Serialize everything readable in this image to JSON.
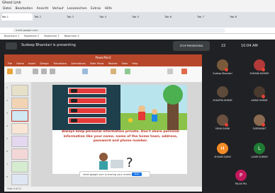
{
  "browser": {
    "title": "Ghost Link",
    "menu": [
      "Datei",
      "Bearbeiten",
      "Ansicht",
      "Verlauf",
      "Lesezeichen",
      "Extras",
      "Hilfe"
    ],
    "tabs": [
      "Tab 1",
      "Tab 2",
      "Tab 3",
      "Tab 4",
      "Tab 5",
      "Tab 6",
      "Tab 7",
      "Tab 8"
    ],
    "address": "meet.google.com",
    "bookmarks": [
      "Bookmark 1",
      "Bookmark 2",
      "Bookmark 3",
      "Bookmark 4"
    ]
  },
  "meet": {
    "presenting_label": "Sudeep Bhandari is presenting",
    "stop_presenting": "STOP PRESENTING",
    "people_count": "22",
    "clock": "10:04 AM"
  },
  "powerpoint": {
    "window_title": "PowerPoint",
    "ribbon_tabs": [
      "File",
      "Home",
      "Insert",
      "Design",
      "Transitions",
      "Animations",
      "Slide Show",
      "Review",
      "View",
      "Help"
    ],
    "slide_text": "Always keep personal information private. Don't share personal information like your name, name of the home town, address, password and phone number.",
    "share_bar_text": "meet.google.com is sharing your screen",
    "share_button": "Stop",
    "status": "Slide 4 of 12",
    "thumbnail_numbers": [
      "1",
      "2",
      "3",
      "4",
      "5",
      "6",
      "7",
      "8"
    ]
  },
  "participants": [
    {
      "name": "Sudeep Bhandari",
      "color": "#7a5a3a"
    },
    {
      "name": "SUHANA KUMARI",
      "color": "#b23a3a"
    },
    {
      "name": "SHAURYA KUMAR",
      "color": "#5d4a3a"
    },
    {
      "name": "AARAV KUMAR",
      "color": "#4a3a2e"
    },
    {
      "name": "SHIVA SAHNI",
      "color": "#6a5040"
    },
    {
      "name": "SURYAKANT",
      "color": "#8a6a50"
    },
    {
      "name": "SHIVAM SAHNI",
      "color": "#f28b25",
      "initial": "H"
    },
    {
      "name": "LAXMI KUMARI",
      "color": "#1e7b34",
      "initial": "L"
    },
    {
      "name": "PALAK PAL",
      "color": "#c2185b",
      "initial": "P"
    }
  ],
  "colors": {
    "ppt_accent": "#b7472a",
    "meet_bg": "#202124",
    "slide_text": "#c0392b"
  }
}
